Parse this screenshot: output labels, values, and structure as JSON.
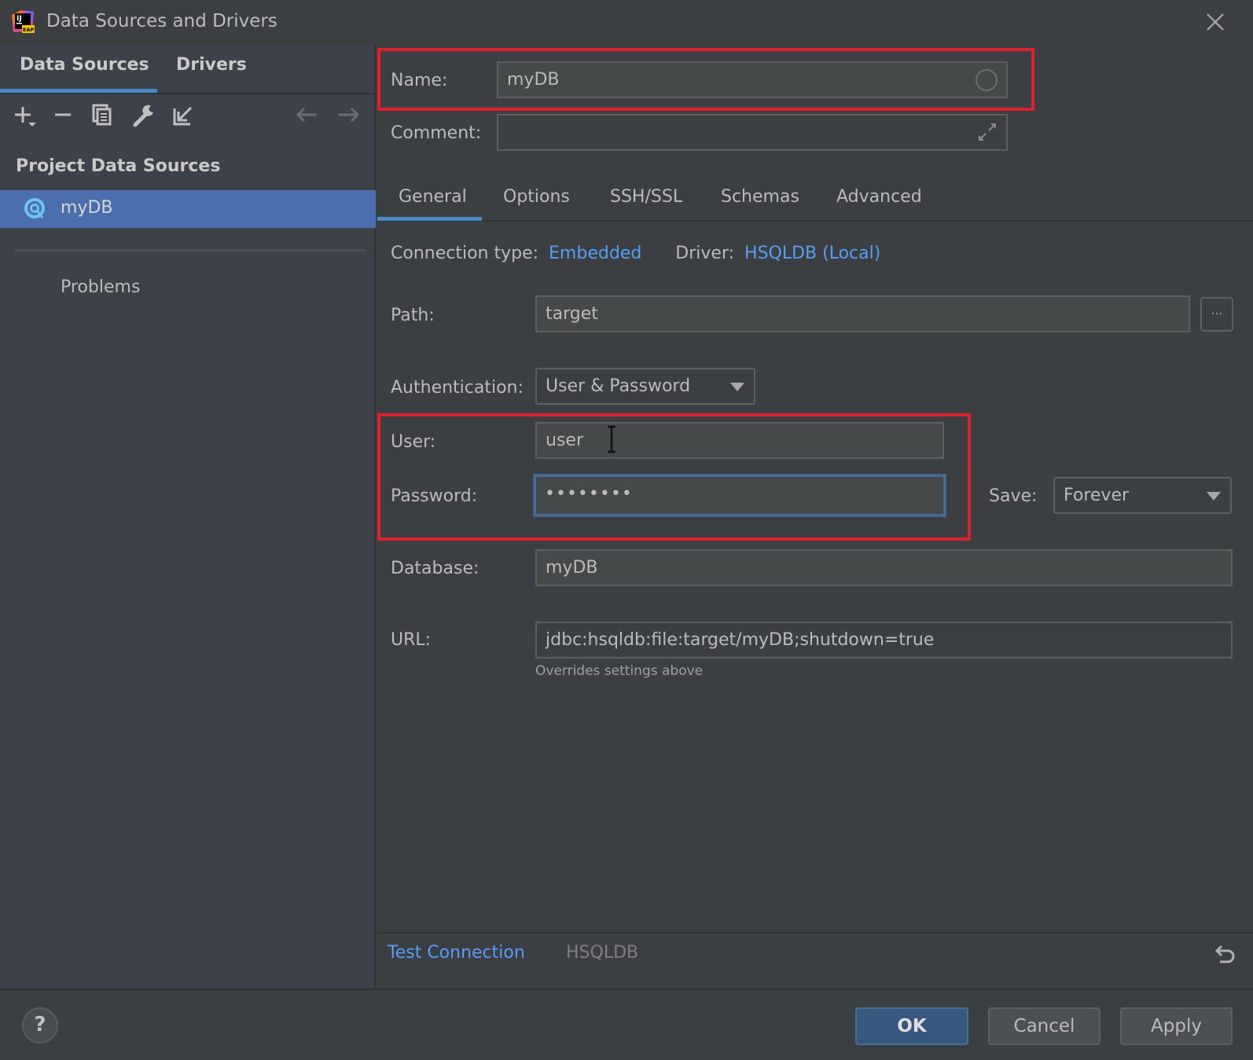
{
  "window": {
    "title": "Data Sources and Drivers",
    "logo_text": "IJ",
    "logo_badge": "EAP"
  },
  "left_panel": {
    "tabs": [
      {
        "label": "Data Sources",
        "active": true
      },
      {
        "label": "Drivers",
        "active": false
      }
    ],
    "toolbar": [
      {
        "icon": "add-icon"
      },
      {
        "icon": "remove-icon"
      },
      {
        "icon": "duplicate-icon"
      },
      {
        "icon": "wrench-icon"
      },
      {
        "icon": "import-icon"
      },
      {
        "icon": "back-arrow-icon"
      },
      {
        "icon": "forward-arrow-icon"
      }
    ],
    "section_label": "Project Data Sources",
    "items": [
      {
        "label": "myDB",
        "icon": "hsqldb-icon",
        "selected": true
      }
    ],
    "problems_label": "Problems"
  },
  "form": {
    "name_label": "Name:",
    "name_value": "myDB",
    "comment_label": "Comment:",
    "comment_value": "",
    "tabs": [
      {
        "label": "General",
        "active": true
      },
      {
        "label": "Options",
        "active": false
      },
      {
        "label": "SSH/SSL",
        "active": false
      },
      {
        "label": "Schemas",
        "active": false
      },
      {
        "label": "Advanced",
        "active": false
      }
    ],
    "connection_type_label": "Connection type:",
    "connection_type_value": "Embedded",
    "driver_label": "Driver:",
    "driver_value": "HSQLDB (Local)",
    "path_label": "Path:",
    "path_value": "target",
    "browse_label": "...",
    "auth_label": "Authentication:",
    "auth_value": "User & Password",
    "user_label": "User:",
    "user_value": "user",
    "password_label": "Password:",
    "password_value": "••••••••",
    "save_label": "Save:",
    "save_value": "Forever",
    "database_label": "Database:",
    "database_value": "myDB",
    "url_label": "URL:",
    "url_value": "jdbc:hsqldb:file:target/myDB;shutdown=true",
    "url_hint": "Overrides settings above"
  },
  "bottom_bar": {
    "test_connection": "Test Connection",
    "driver_name": "HSQLDB"
  },
  "footer": {
    "help": "?",
    "ok": "OK",
    "cancel": "Cancel",
    "apply": "Apply"
  },
  "colors": {
    "accent": "#4a88c7",
    "link": "#589df6",
    "selection": "#4b6eaf",
    "highlight_box": "#e0202a",
    "ok_button": "#365880"
  }
}
